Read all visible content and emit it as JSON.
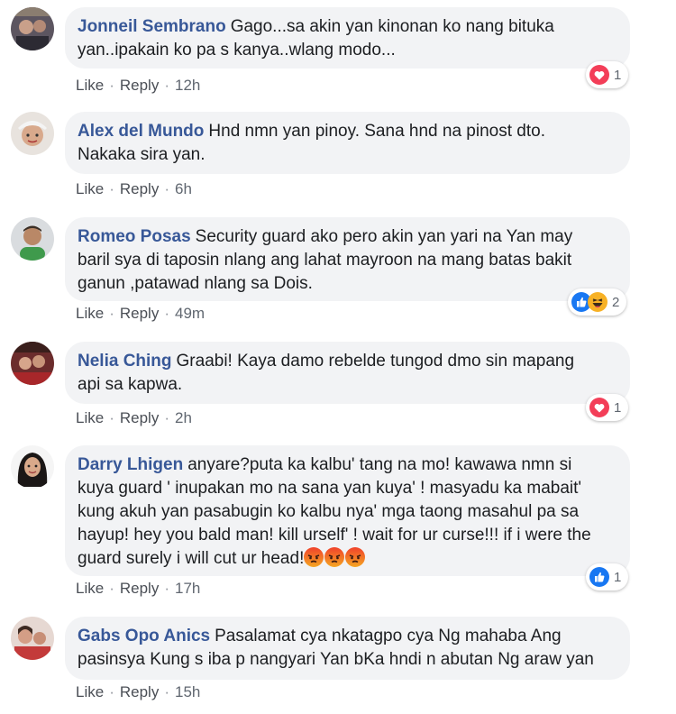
{
  "comments": [
    {
      "author": "Jonneil Sembrano",
      "text_lines": [
        "Gago...sa akin yan kinonan ko nang bituka",
        "yan..ipakain ko pa s kanya..wlang modo..."
      ],
      "like": "Like",
      "reply": "Reply",
      "time": "12h",
      "reaction_icons": [
        "love-icon"
      ],
      "reaction_count": "1"
    },
    {
      "author": "Alex del Mundo",
      "text_lines": [
        "Hnd nmn yan pinoy. Sana hnd na pinost dto.",
        "Nakaka sira yan."
      ],
      "like": "Like",
      "reply": "Reply",
      "time": "6h"
    },
    {
      "author": "Romeo Posas",
      "text_lines": [
        "Security guard ako pero akin yan yari na Yan may",
        "baril sya di taposin nlang ang lahat mayroon na mang batas bakit",
        "ganun ,patawad nlang sa Dois."
      ],
      "like": "Like",
      "reply": "Reply",
      "time": "49m",
      "reaction_icons": [
        "like-icon",
        "haha-icon"
      ],
      "reaction_count": "2"
    },
    {
      "author": "Nelia Ching",
      "text_lines": [
        "Graabi! Kaya damo rebelde tungod dmo sin mapang",
        "api sa kapwa."
      ],
      "like": "Like",
      "reply": "Reply",
      "time": "2h",
      "reaction_icons": [
        "love-icon"
      ],
      "reaction_count": "1"
    },
    {
      "author": "Darry Lhigen",
      "text_lines": [
        "anyare?puta ka kalbu' tang na mo! kawawa nmn si",
        "kuya guard ' inupakan mo na sana yan kuya' ! masyadu ka mabait'",
        "kung akuh yan pasabugin ko kalbu nya' mga taong masahul pa sa",
        "hayup! hey you bald man! kill urself' ! wait for ur curse!!! if i were the",
        "guard surely i will cut ur head!"
      ],
      "emoji_icons": [
        "angry-face-icon",
        "angry-face-icon",
        "angry-face-icon"
      ],
      "like": "Like",
      "reply": "Reply",
      "time": "17h",
      "reaction_icons": [
        "like-icon"
      ],
      "reaction_count": "1"
    },
    {
      "author": "Gabs Opo Anics",
      "text_lines": [
        "Pasalamat cya nkatagpo cya Ng mahaba Ang",
        "pasinsya Kung s iba p nangyari Yan bKa hndi n abutan Ng araw yan"
      ],
      "like": "Like",
      "reply": "Reply",
      "time": "15h"
    }
  ],
  "colors": {
    "author": "#385898",
    "bubble": "#f2f3f5",
    "meta": "#606770",
    "love": "#f33e58",
    "like": "#1877f2",
    "haha": "#f7b125",
    "angry": "#e9710f"
  }
}
